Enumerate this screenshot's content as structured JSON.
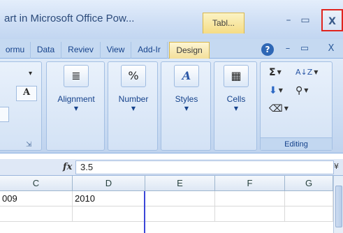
{
  "window": {
    "title": "art in Microsoft Office Pow...",
    "context_tab": "Tabl...",
    "minimize": "–",
    "maximize": "▭",
    "close": "X"
  },
  "tabs": [
    {
      "label": "ormu"
    },
    {
      "label": "Data"
    },
    {
      "label": "Reviev"
    },
    {
      "label": "View"
    },
    {
      "label": "Add-Ir"
    },
    {
      "label": "Design"
    }
  ],
  "strip_icons": {
    "help": "?",
    "minimize": "–",
    "restore": "▭",
    "close": "X"
  },
  "ribbon": {
    "font_group": {
      "font_size_dropdown": "▾",
      "font_grow": "A",
      "launcher": "⇲"
    },
    "alignment": {
      "label": "Alignment",
      "icon": "≣"
    },
    "number": {
      "label": "Number",
      "icon": "%"
    },
    "styles": {
      "label": "Styles",
      "icon": "A"
    },
    "cells": {
      "label": "Cells",
      "icon": "▦"
    },
    "editing": {
      "label": "Editing",
      "autosum": "Σ",
      "sort_filter": "A↓Z",
      "fill": "⬇",
      "find_select": "⚲",
      "clear": "⌫"
    }
  },
  "formula_bar": {
    "fx": "fx",
    "value": "3.5",
    "expand": "¥"
  },
  "columns": [
    "C",
    "D",
    "E",
    "F",
    "G"
  ],
  "rows": [
    {
      "C": "009",
      "D": "2010",
      "E": "",
      "F": "",
      "G": ""
    },
    {
      "C": "",
      "D": "",
      "E": "",
      "F": "",
      "G": ""
    }
  ],
  "colors": {
    "accent": "#15428b",
    "close_highlight": "#e0241e",
    "selection_line": "#3b46d8"
  }
}
